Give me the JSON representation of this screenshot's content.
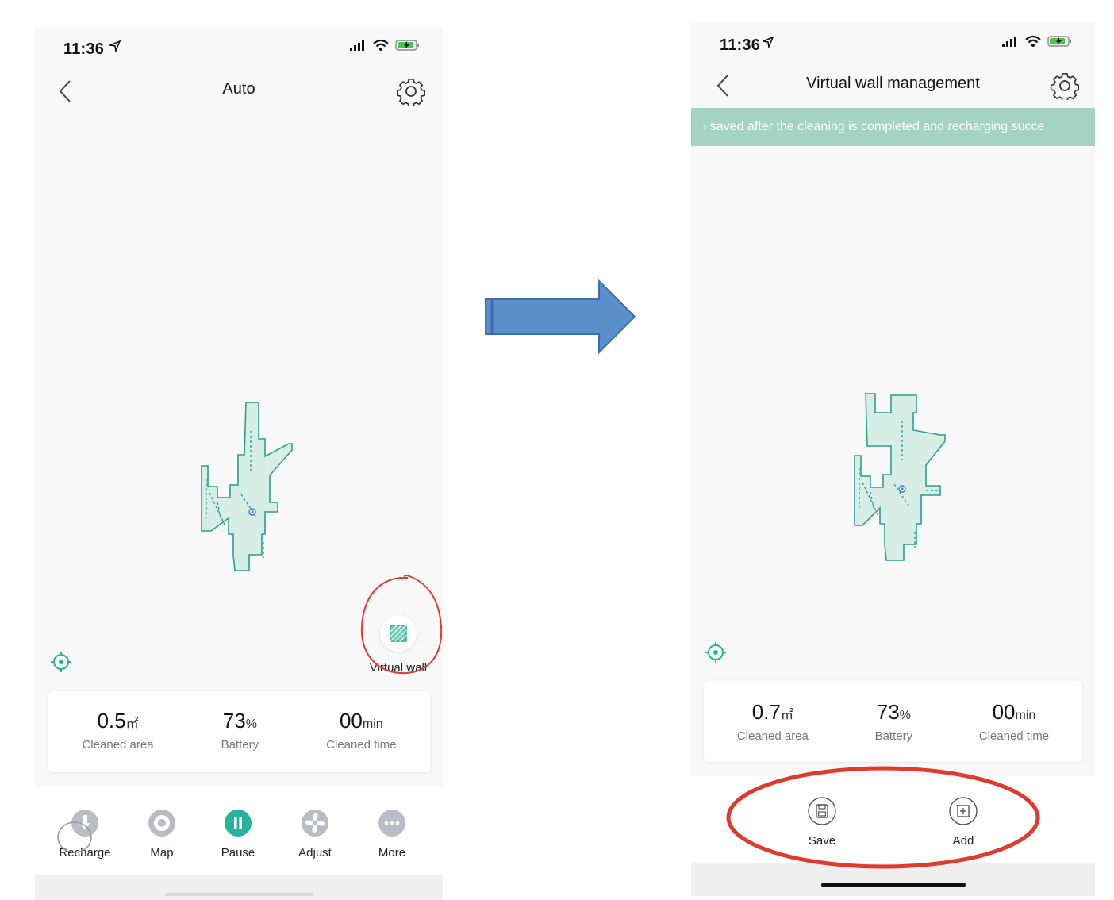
{
  "left_screen": {
    "status": {
      "time": "11:36"
    },
    "title": "Auto",
    "stats": [
      {
        "value": "0.5",
        "unit": "㎡",
        "label": "Cleaned area"
      },
      {
        "value": "73",
        "unit": "%",
        "label": "Battery"
      },
      {
        "value": "00",
        "unit": "min",
        "label": "Cleaned time"
      }
    ],
    "virtual_wall_label": "Virtual wall",
    "toolbar": [
      {
        "label": "Recharge",
        "icon": "recharge-icon"
      },
      {
        "label": "Map",
        "icon": "map-pin-icon"
      },
      {
        "label": "Pause",
        "icon": "pause-icon"
      },
      {
        "label": "Adjust",
        "icon": "fan-icon"
      },
      {
        "label": "More",
        "icon": "more-icon"
      }
    ]
  },
  "right_screen": {
    "status": {
      "time": "11:36"
    },
    "title": "Virtual wall management",
    "banner": "› saved after the cleaning is completed and recharging succe",
    "stats": [
      {
        "value": "0.7",
        "unit": "㎡",
        "label": "Cleaned area"
      },
      {
        "value": "73",
        "unit": "%",
        "label": "Battery"
      },
      {
        "value": "00",
        "unit": "min",
        "label": "Cleaned time"
      }
    ],
    "actions": [
      {
        "label": "Save",
        "icon": "save-icon"
      },
      {
        "label": "Add",
        "icon": "add-icon"
      }
    ]
  },
  "colors": {
    "accent": "#27b39b",
    "map_fill": "#d7eee6",
    "map_edge": "#2e9e8c",
    "banner": "#a4d3c4",
    "arrow": "#5b8fc9",
    "annotation_red": "#e03a2f"
  }
}
